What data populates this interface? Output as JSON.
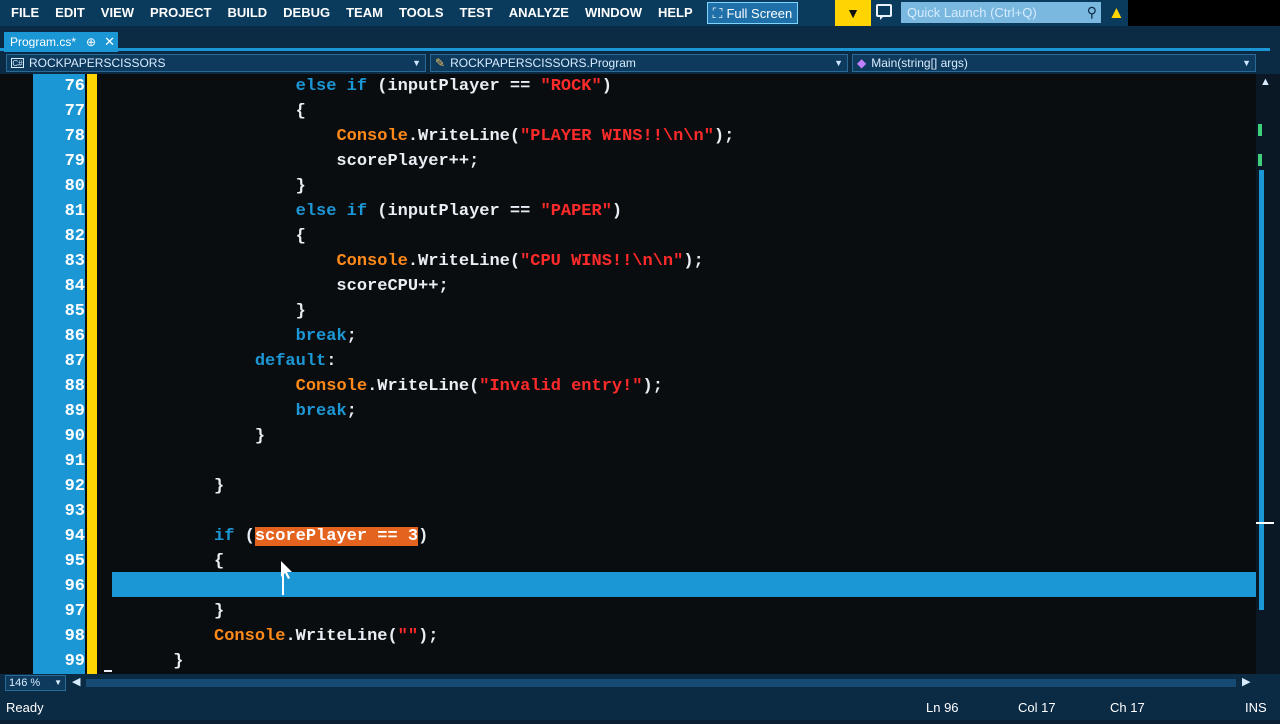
{
  "menu": {
    "items": [
      "FILE",
      "EDIT",
      "VIEW",
      "PROJECT",
      "BUILD",
      "DEBUG",
      "TEAM",
      "TOOLS",
      "TEST",
      "ANALYZE",
      "WINDOW",
      "HELP"
    ],
    "fullscreen_label": "Full Screen"
  },
  "quick_launch": {
    "placeholder": "Quick Launch (Ctrl+Q)"
  },
  "tab": {
    "label": "Program.cs*"
  },
  "nav": {
    "project": "ROCKPAPERSCISSORS",
    "type": "ROCKPAPERSCISSORS.Program",
    "member": "Main(string[] args)"
  },
  "code_lines": [
    {
      "ln": "76",
      "segs": [
        [
          "                  ",
          "pl"
        ],
        [
          "else if",
          "kw"
        ],
        [
          " (inputPlayer == ",
          "pl"
        ],
        [
          "\"ROCK\"",
          "st"
        ],
        [
          ")",
          "pl"
        ]
      ]
    },
    {
      "ln": "77",
      "segs": [
        [
          "                  {",
          "pl"
        ]
      ]
    },
    {
      "ln": "78",
      "segs": [
        [
          "                      ",
          "pl"
        ],
        [
          "Console",
          "ty"
        ],
        [
          ".WriteLine(",
          "pl"
        ],
        [
          "\"PLAYER WINS!!\\n\\n\"",
          "st"
        ],
        [
          ");",
          "pl"
        ]
      ]
    },
    {
      "ln": "79",
      "segs": [
        [
          "                      scorePlayer++;",
          "pl"
        ]
      ]
    },
    {
      "ln": "80",
      "segs": [
        [
          "                  }",
          "pl"
        ]
      ]
    },
    {
      "ln": "81",
      "segs": [
        [
          "                  ",
          "pl"
        ],
        [
          "else if",
          "kw"
        ],
        [
          " (inputPlayer == ",
          "pl"
        ],
        [
          "\"PAPER\"",
          "st"
        ],
        [
          ")",
          "pl"
        ]
      ]
    },
    {
      "ln": "82",
      "segs": [
        [
          "                  {",
          "pl"
        ]
      ]
    },
    {
      "ln": "83",
      "segs": [
        [
          "                      ",
          "pl"
        ],
        [
          "Console",
          "ty"
        ],
        [
          ".WriteLine(",
          "pl"
        ],
        [
          "\"CPU WINS!!\\n\\n\"",
          "st"
        ],
        [
          ");",
          "pl"
        ]
      ]
    },
    {
      "ln": "84",
      "segs": [
        [
          "                      scoreCPU++;",
          "pl"
        ]
      ]
    },
    {
      "ln": "85",
      "segs": [
        [
          "                  }",
          "pl"
        ]
      ]
    },
    {
      "ln": "86",
      "segs": [
        [
          "                  ",
          "pl"
        ],
        [
          "break",
          "kw"
        ],
        [
          ";",
          "pl"
        ]
      ]
    },
    {
      "ln": "87",
      "segs": [
        [
          "              ",
          "pl"
        ],
        [
          "default",
          "kw"
        ],
        [
          ":",
          "pl"
        ]
      ]
    },
    {
      "ln": "88",
      "segs": [
        [
          "                  ",
          "pl"
        ],
        [
          "Console",
          "ty"
        ],
        [
          ".WriteLine(",
          "pl"
        ],
        [
          "\"Invalid entry!\"",
          "st"
        ],
        [
          ");",
          "pl"
        ]
      ]
    },
    {
      "ln": "89",
      "segs": [
        [
          "                  ",
          "pl"
        ],
        [
          "break",
          "kw"
        ],
        [
          ";",
          "pl"
        ]
      ]
    },
    {
      "ln": "90",
      "segs": [
        [
          "              }",
          "pl"
        ]
      ]
    },
    {
      "ln": "91",
      "segs": []
    },
    {
      "ln": "92",
      "segs": [
        [
          "          }",
          "pl"
        ]
      ]
    },
    {
      "ln": "93",
      "segs": []
    },
    {
      "ln": "94",
      "segs": [
        [
          "          ",
          "pl"
        ],
        [
          "if",
          "kw"
        ],
        [
          " (",
          "pl"
        ],
        [
          "scorePlayer == 3",
          "hl"
        ],
        [
          ")",
          "pl"
        ]
      ]
    },
    {
      "ln": "95",
      "segs": [
        [
          "          {",
          "pl"
        ]
      ]
    },
    {
      "ln": "96",
      "segs": []
    },
    {
      "ln": "97",
      "segs": [
        [
          "          }",
          "pl"
        ]
      ]
    },
    {
      "ln": "98",
      "segs": [
        [
          "          ",
          "pl"
        ],
        [
          "Console",
          "ty"
        ],
        [
          ".WriteLine(",
          "pl"
        ],
        [
          "\"\"",
          "st"
        ],
        [
          ");",
          "pl"
        ]
      ]
    },
    {
      "ln": "99",
      "segs": [
        [
          "      }",
          "pl"
        ]
      ]
    }
  ],
  "zoom": "146 %",
  "status": {
    "state": "Ready",
    "line": "Ln 96",
    "col": "Col 17",
    "ch": "Ch 17",
    "mode": "INS"
  },
  "colors": {
    "accent": "#1c97d6",
    "keyword": "#1c97d6",
    "type": "#ff8a1a",
    "string": "#ff2a2a",
    "highlight": "#e4631e",
    "changebar": "#ffd400"
  }
}
